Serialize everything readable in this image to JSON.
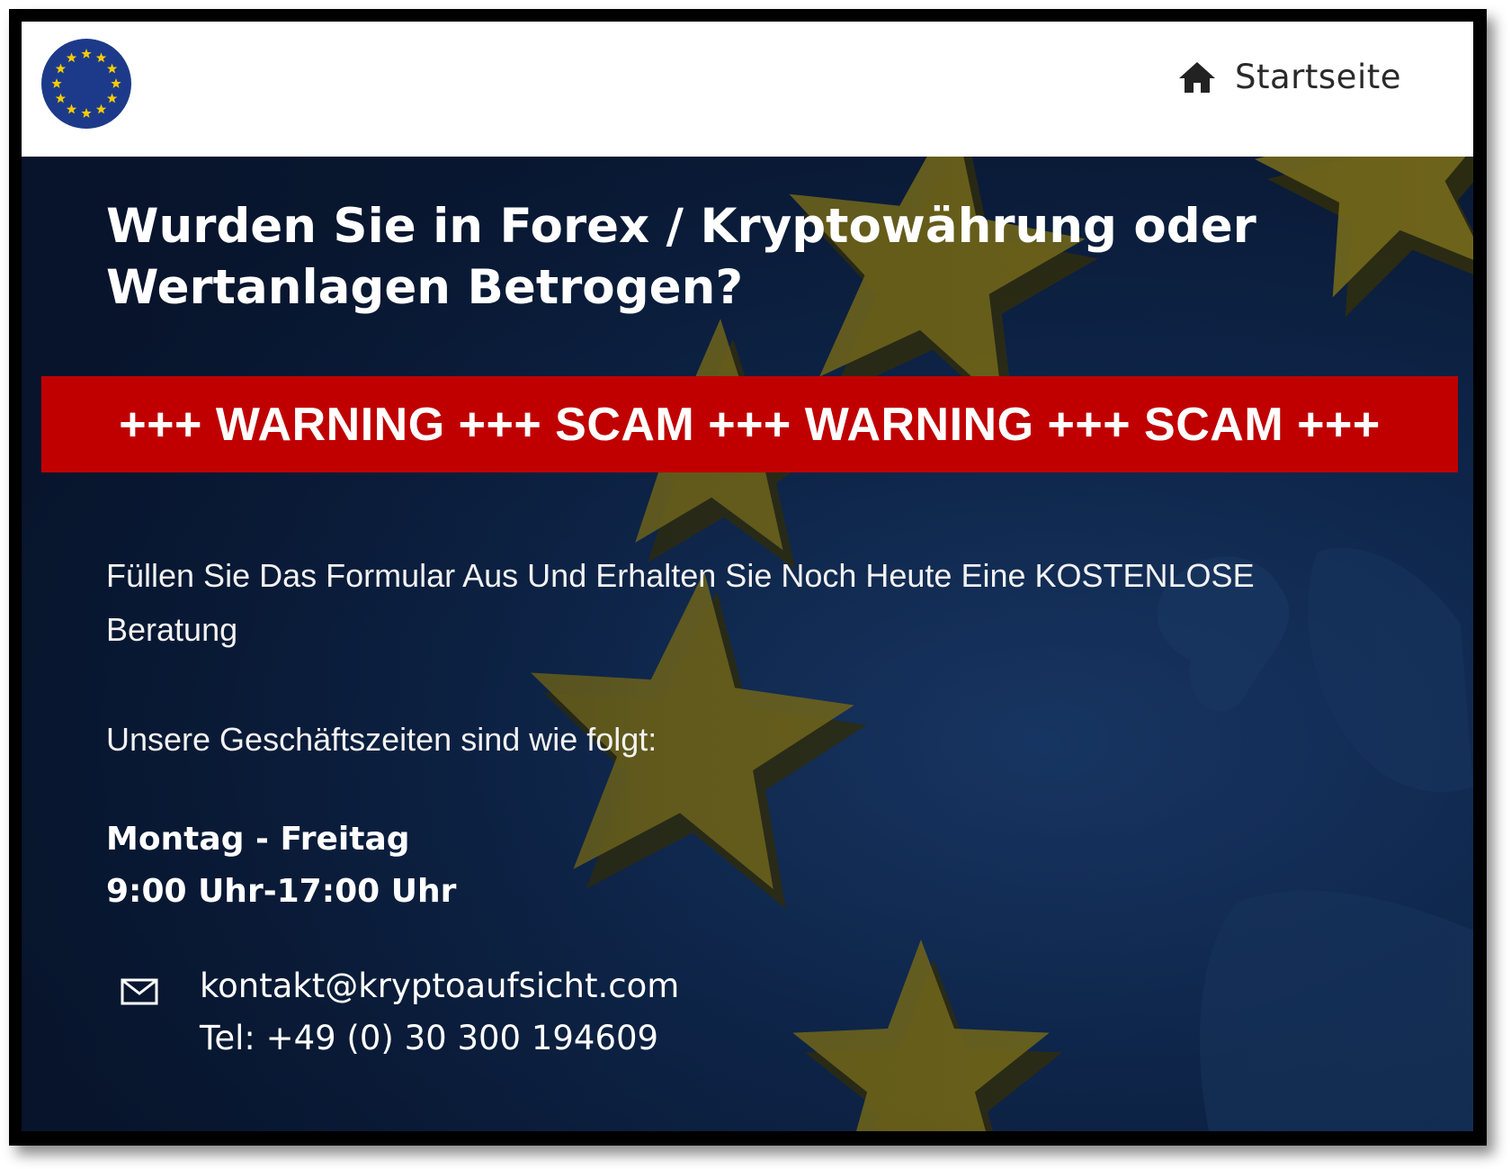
{
  "header": {
    "nav_home_label": "Startseite"
  },
  "hero": {
    "title_line1": "Wurden Sie in Forex / Kryptowährung oder",
    "title_line2": "Wertanlagen Betrogen?",
    "intro_line1": "Füllen Sie Das Formular Aus Und Erhalten Sie Noch Heute Eine KOSTENLOSE",
    "intro_line2": "Beratung",
    "hours_intro": "Unsere Geschäftszeiten sind wie folgt:",
    "hours_days": "Montag - Freitag",
    "hours_time": "9:00 Uhr-17:00 Uhr",
    "contact_email": "kontakt@kryptoaufsicht.com",
    "contact_phone": "Tel: +49 (0) 30 300 194609"
  },
  "banner": {
    "text": "+++ WARNING +++ SCAM +++ WARNING +++ SCAM +++"
  },
  "colors": {
    "banner_red": "#c00000",
    "hero_navy": "#0c1f3c",
    "eu_blue": "#1d3a8a",
    "eu_star_gold": "#f5cc00"
  }
}
